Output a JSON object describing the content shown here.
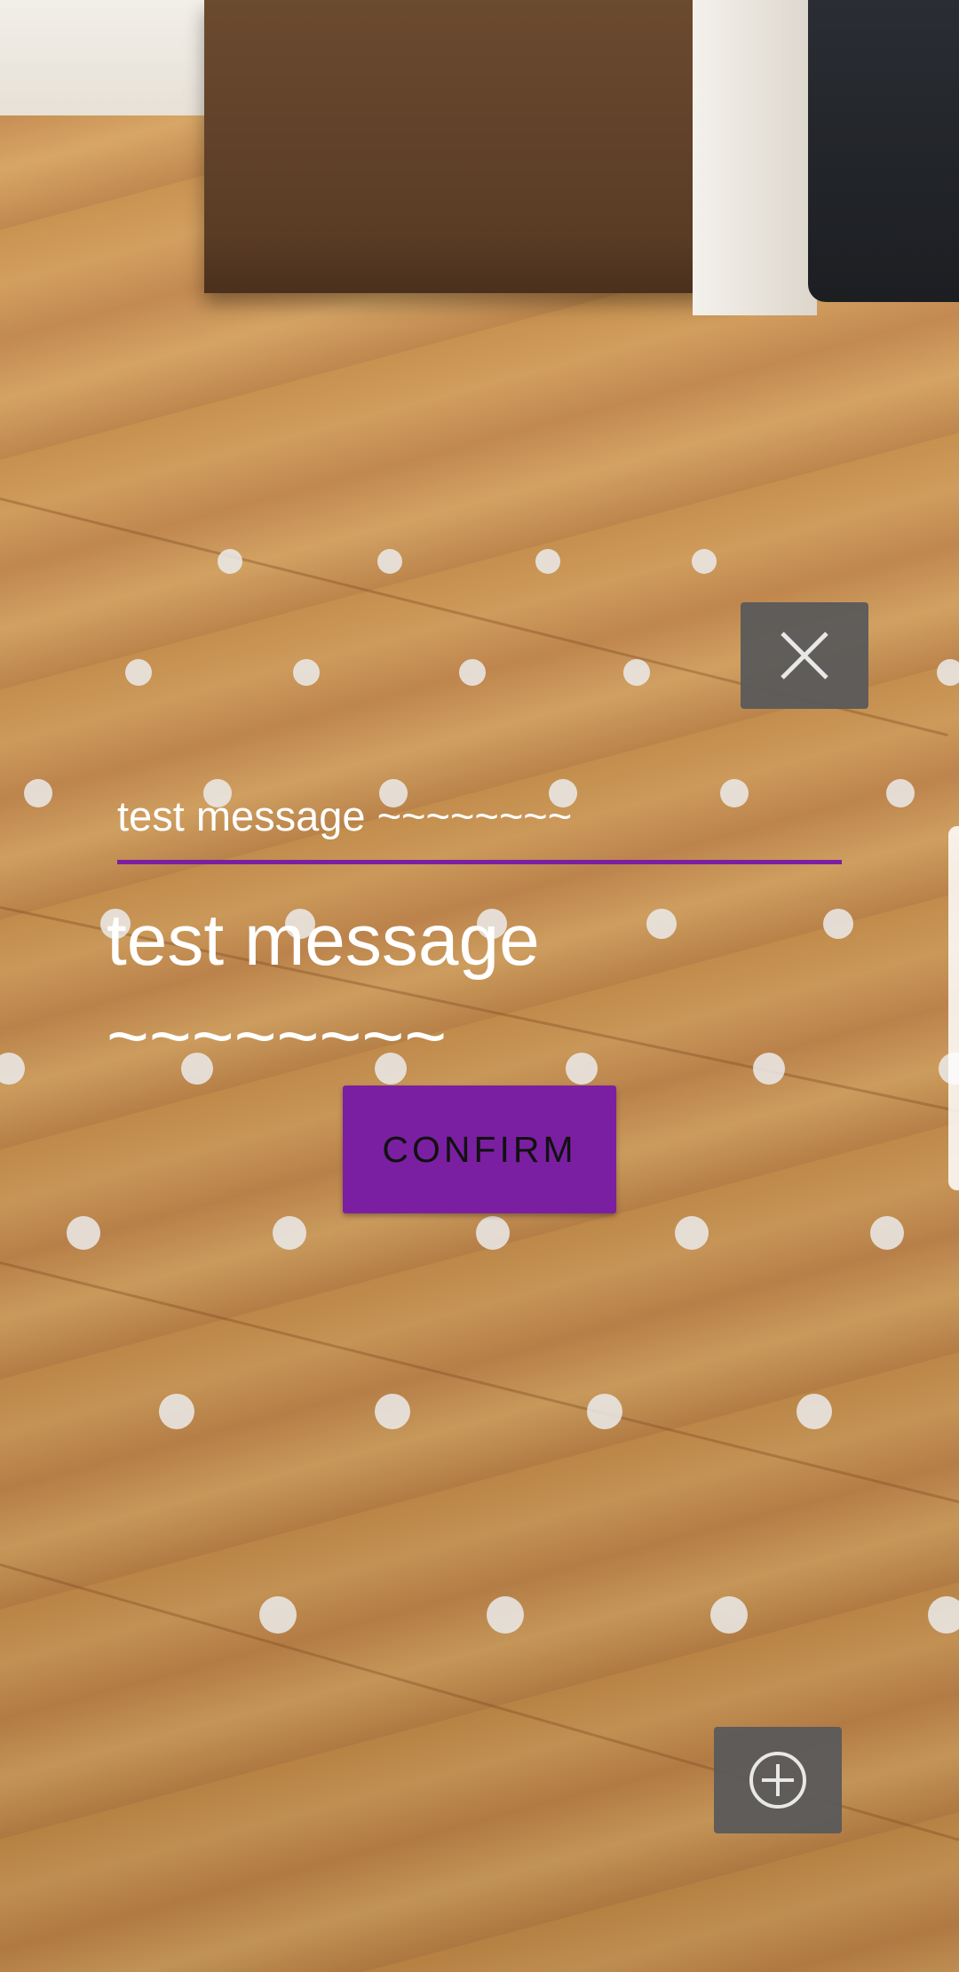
{
  "ar_view": {
    "close_icon": "close-icon",
    "add_icon": "add-circle-icon"
  },
  "message_input": {
    "value": "test message ~~~~~~~~",
    "placeholder": ""
  },
  "echo": {
    "text": "test message ~~~~~~~~"
  },
  "confirm": {
    "label": "CONFIRM"
  },
  "colors": {
    "accent": "#7b1fa2",
    "overlay_button": "#5a5a5a"
  }
}
